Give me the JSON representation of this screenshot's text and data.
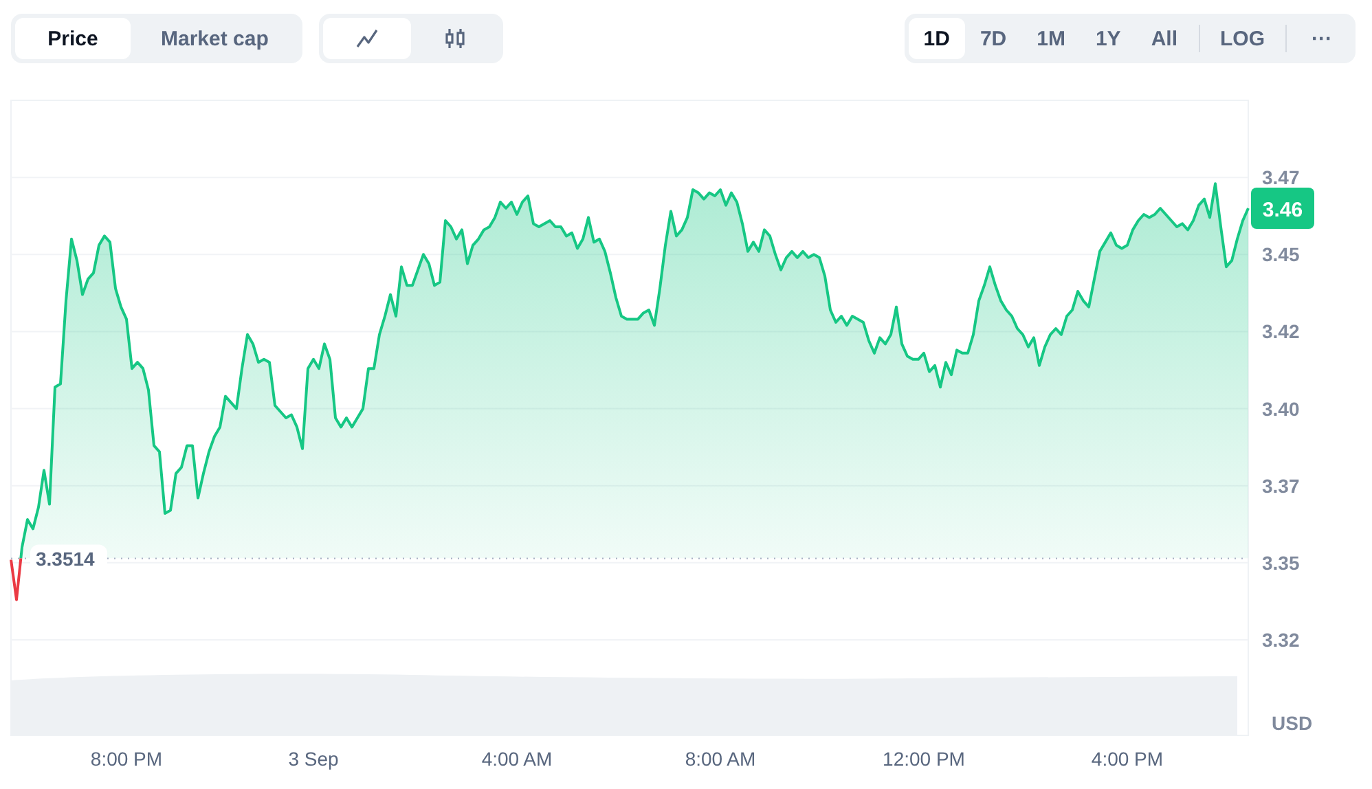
{
  "price_type_tabs": [
    {
      "label": "Price",
      "selected": true
    },
    {
      "label": "Market cap",
      "selected": false
    }
  ],
  "chart_style_tabs": [
    {
      "kind": "line",
      "selected": true
    },
    {
      "kind": "candlestick",
      "selected": false
    }
  ],
  "range_tabs": [
    {
      "label": "1D",
      "selected": true
    },
    {
      "label": "7D",
      "selected": false
    },
    {
      "label": "1M",
      "selected": false
    },
    {
      "label": "1Y",
      "selected": false
    },
    {
      "label": "All",
      "selected": false
    }
  ],
  "log_button": {
    "label": "LOG"
  },
  "more_button": {
    "label": "···"
  },
  "chart": {
    "chart_data": {
      "type": "area",
      "ylabel": "USD",
      "categories": [
        null,
        null,
        null,
        null,
        null,
        null,
        null,
        null,
        null,
        null,
        null,
        null,
        null,
        null,
        null,
        null,
        null,
        null,
        null,
        null,
        null,
        "8:00 PM",
        null,
        null,
        null,
        null,
        null,
        null,
        null,
        null,
        null,
        null,
        null,
        null,
        null,
        null,
        null,
        null,
        null,
        null,
        null,
        null,
        null,
        null,
        null,
        null,
        null,
        null,
        null,
        null,
        null,
        null,
        null,
        null,
        null,
        "3 Sep",
        null,
        null,
        null,
        null,
        null,
        null,
        null,
        null,
        null,
        null,
        null,
        null,
        null,
        null,
        null,
        null,
        null,
        null,
        null,
        null,
        null,
        null,
        null,
        null,
        null,
        null,
        null,
        null,
        null,
        null,
        null,
        null,
        null,
        null,
        null,
        null,
        "4:00 AM",
        null,
        null,
        null,
        null,
        null,
        null,
        null,
        null,
        null,
        null,
        null,
        null,
        null,
        null,
        null,
        null,
        null,
        null,
        null,
        null,
        null,
        null,
        null,
        null,
        null,
        null,
        null,
        null,
        null,
        null,
        null,
        null,
        null,
        null,
        null,
        null,
        "8:00 AM",
        null,
        null,
        null,
        null,
        null,
        null,
        null,
        null,
        null,
        null,
        null,
        null,
        null,
        null,
        null,
        null,
        null,
        null,
        null,
        null,
        null,
        null,
        null,
        null,
        null,
        null,
        null,
        null,
        null,
        null,
        null,
        null,
        null,
        null,
        null,
        null,
        "12:00 PM",
        null,
        null,
        null,
        null,
        null,
        null,
        null,
        null,
        null,
        null,
        null,
        null,
        null,
        null,
        null,
        null,
        null,
        null,
        null,
        null,
        null,
        null,
        null,
        null,
        null,
        null,
        null,
        null,
        null,
        null,
        null,
        null,
        null,
        null,
        null,
        null,
        "4:00 PM",
        null,
        null,
        null,
        null,
        null,
        null,
        null,
        null,
        null,
        null,
        null,
        null,
        null,
        null,
        null,
        null,
        null,
        null,
        null,
        null,
        null,
        null
      ],
      "series": [
        {
          "color": "#16c784",
          "values": [
            3.351,
            3.338,
            3.355,
            3.364,
            3.361,
            3.368,
            3.38,
            3.369,
            3.407,
            3.408,
            3.435,
            3.455,
            3.448,
            3.437,
            3.442,
            3.444,
            3.453,
            3.456,
            3.454,
            3.439,
            3.433,
            3.429,
            3.413,
            3.415,
            3.413,
            3.406,
            3.388,
            3.386,
            3.366,
            3.367,
            3.379,
            3.381,
            3.388,
            3.388,
            3.371,
            3.379,
            3.386,
            3.391,
            3.394,
            3.404,
            3.402,
            3.4,
            3.413,
            3.424,
            3.421,
            3.415,
            3.416,
            3.415,
            3.401,
            3.399,
            3.397,
            3.398,
            3.394,
            3.387,
            3.413,
            3.416,
            3.413,
            3.421,
            3.416,
            3.397,
            3.394,
            3.397,
            3.394,
            3.397,
            3.4,
            3.413,
            3.413,
            3.424,
            3.43,
            3.437,
            3.43,
            3.446,
            3.44,
            3.44,
            3.445,
            3.45,
            3.447,
            3.44,
            3.441,
            3.461,
            3.459,
            3.455,
            3.458,
            3.447,
            3.453,
            3.455,
            3.458,
            3.459,
            3.462,
            3.467,
            3.465,
            3.467,
            3.463,
            3.467,
            3.469,
            3.46,
            3.459,
            3.46,
            3.461,
            3.459,
            3.459,
            3.456,
            3.457,
            3.452,
            3.455,
            3.462,
            3.454,
            3.455,
            3.451,
            3.444,
            3.436,
            3.43,
            3.429,
            3.429,
            3.429,
            3.431,
            3.432,
            3.427,
            3.439,
            3.453,
            3.464,
            3.456,
            3.458,
            3.462,
            3.471,
            3.47,
            3.468,
            3.47,
            3.469,
            3.471,
            3.466,
            3.47,
            3.467,
            3.46,
            3.451,
            3.454,
            3.451,
            3.458,
            3.456,
            3.45,
            3.445,
            3.449,
            3.451,
            3.449,
            3.451,
            3.449,
            3.45,
            3.449,
            3.443,
            3.432,
            3.428,
            3.43,
            3.427,
            3.43,
            3.429,
            3.428,
            3.422,
            3.418,
            3.423,
            3.421,
            3.424,
            3.433,
            3.421,
            3.417,
            3.416,
            3.416,
            3.418,
            3.412,
            3.414,
            3.407,
            3.415,
            3.411,
            3.419,
            3.418,
            3.418,
            3.424,
            3.435,
            3.44,
            3.446,
            3.44,
            3.435,
            3.432,
            3.43,
            3.426,
            3.424,
            3.42,
            3.423,
            3.414,
            3.42,
            3.424,
            3.426,
            3.424,
            3.43,
            3.432,
            3.438,
            3.435,
            3.433,
            3.442,
            3.451,
            3.454,
            3.457,
            3.453,
            3.452,
            3.453,
            3.458,
            3.461,
            3.463,
            3.462,
            3.463,
            3.465,
            3.463,
            3.461,
            3.459,
            3.46,
            3.458,
            3.461,
            3.466,
            3.468,
            3.462,
            3.473,
            3.459,
            3.446,
            3.448,
            3.455,
            3.461,
            3.465
          ]
        }
      ],
      "ylim": [
        3.294,
        3.5
      ],
      "yticks": [
        {
          "value": 3.475,
          "label": "3.47"
        },
        {
          "value": 3.45,
          "label": "3.45"
        },
        {
          "value": 3.425,
          "label": "3.42"
        },
        {
          "value": 3.4,
          "label": "3.40"
        },
        {
          "value": 3.375,
          "label": "3.37"
        },
        {
          "value": 3.35,
          "label": "3.35"
        },
        {
          "value": 3.325,
          "label": "3.32"
        }
      ],
      "grid": true,
      "ref_lines": [
        {
          "axis": "y",
          "value": 3.3514,
          "label": "3.3514"
        }
      ],
      "annotations": [
        "3.46"
      ]
    }
  }
}
